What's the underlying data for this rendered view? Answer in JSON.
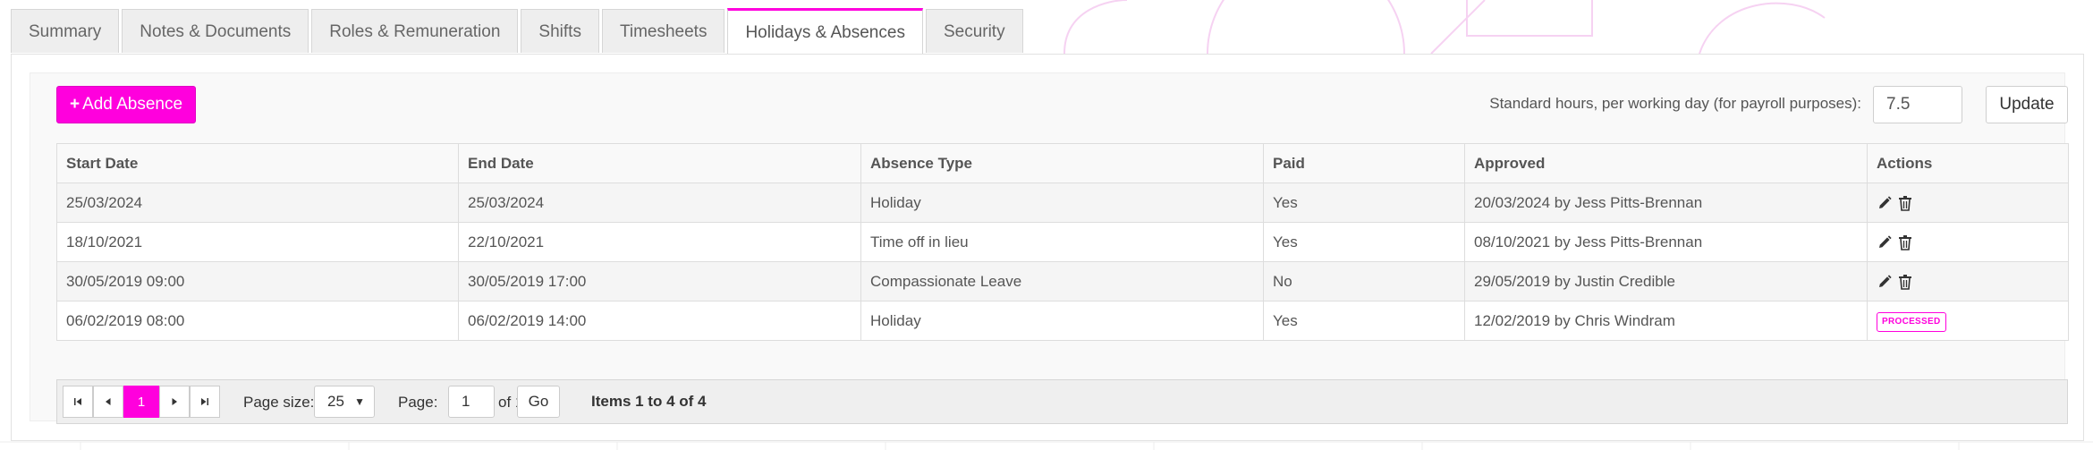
{
  "tabs": [
    {
      "label": "Summary",
      "active": false
    },
    {
      "label": "Notes & Documents",
      "active": false
    },
    {
      "label": "Roles & Remuneration",
      "active": false
    },
    {
      "label": "Shifts",
      "active": false
    },
    {
      "label": "Timesheets",
      "active": false
    },
    {
      "label": "Holidays & Absences",
      "active": true
    },
    {
      "label": "Security",
      "active": false
    }
  ],
  "toolbar": {
    "add_icon": "plus-icon",
    "add_label": "Add Absence",
    "standard_hours_label": "Standard hours, per working day (for payroll purposes):",
    "standard_hours_value": "7.5",
    "update_label": "Update"
  },
  "table": {
    "headers": [
      "Start Date",
      "End Date",
      "Absence Type",
      "Paid",
      "Approved",
      "Actions"
    ],
    "rows": [
      {
        "start": "25/03/2024",
        "end": "25/03/2024",
        "type": "Holiday",
        "paid": "Yes",
        "approved": "20/03/2024 by Jess Pitts-Brennan",
        "status": ""
      },
      {
        "start": "18/10/2021",
        "end": "22/10/2021",
        "type": "Time off in lieu",
        "paid": "Yes",
        "approved": "08/10/2021 by Jess Pitts-Brennan",
        "status": ""
      },
      {
        "start": "30/05/2019 09:00",
        "end": "30/05/2019 17:00",
        "type": "Compassionate Leave",
        "paid": "No",
        "approved": "29/05/2019 by Justin Credible",
        "status": ""
      },
      {
        "start": "06/02/2019 08:00",
        "end": "06/02/2019 14:00",
        "type": "Holiday",
        "paid": "Yes",
        "approved": "12/02/2019 by Chris Windram",
        "status": "PROCESSED"
      }
    ],
    "action_icons": [
      "pencil-icon",
      "trash-icon"
    ]
  },
  "pager": {
    "current_page": "1",
    "page_size_label": "Page size:",
    "page_size": "25",
    "page_label": "Page:",
    "page_value": "1",
    "of_label": "of 1",
    "go_label": "Go",
    "items_label": "Items 1 to 4 of 4"
  },
  "colors": {
    "accent": "#ff00dd",
    "tab_bg": "#eeeeee",
    "row_alt": "#f5f5f5",
    "border": "#dddddd"
  }
}
